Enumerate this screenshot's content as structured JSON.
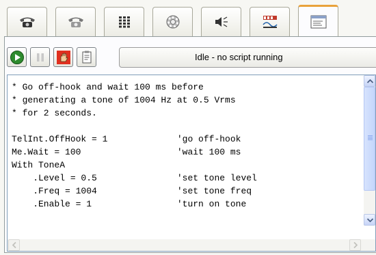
{
  "tabs": [
    {
      "icon": "telephone-icon"
    },
    {
      "icon": "telephone-handset-icon"
    },
    {
      "icon": "keypad-icon"
    },
    {
      "icon": "rotary-dial-icon"
    },
    {
      "icon": "speaker-icon"
    },
    {
      "icon": "signal-meter-icon"
    },
    {
      "icon": "script-window-icon",
      "active": true
    }
  ],
  "toolbar": [
    {
      "icon": "play-icon",
      "color": "#2e8b2e"
    },
    {
      "icon": "pause-icon"
    },
    {
      "icon": "stop-hand-icon",
      "color": "#e03020"
    },
    {
      "icon": "clipboard-icon"
    }
  ],
  "status": {
    "text": "Idle - no script running"
  },
  "script": {
    "lines": [
      "* Go off-hook and wait 100 ms before",
      "* generating a tone of 1004 Hz at 0.5 Vrms",
      "* for 2 seconds.",
      "",
      "TelInt.OffHook = 1             'go off-hook",
      "Me.Wait = 100                  'wait 100 ms",
      "With ToneA",
      "    .Level = 0.5               'set tone level",
      "    .Freq = 1004               'set tone freq",
      "    .Enable = 1                'turn on tone"
    ]
  },
  "colors": {
    "active_tab_accent": "#e9a23b",
    "scroll_accent": "#c6d4f7"
  }
}
